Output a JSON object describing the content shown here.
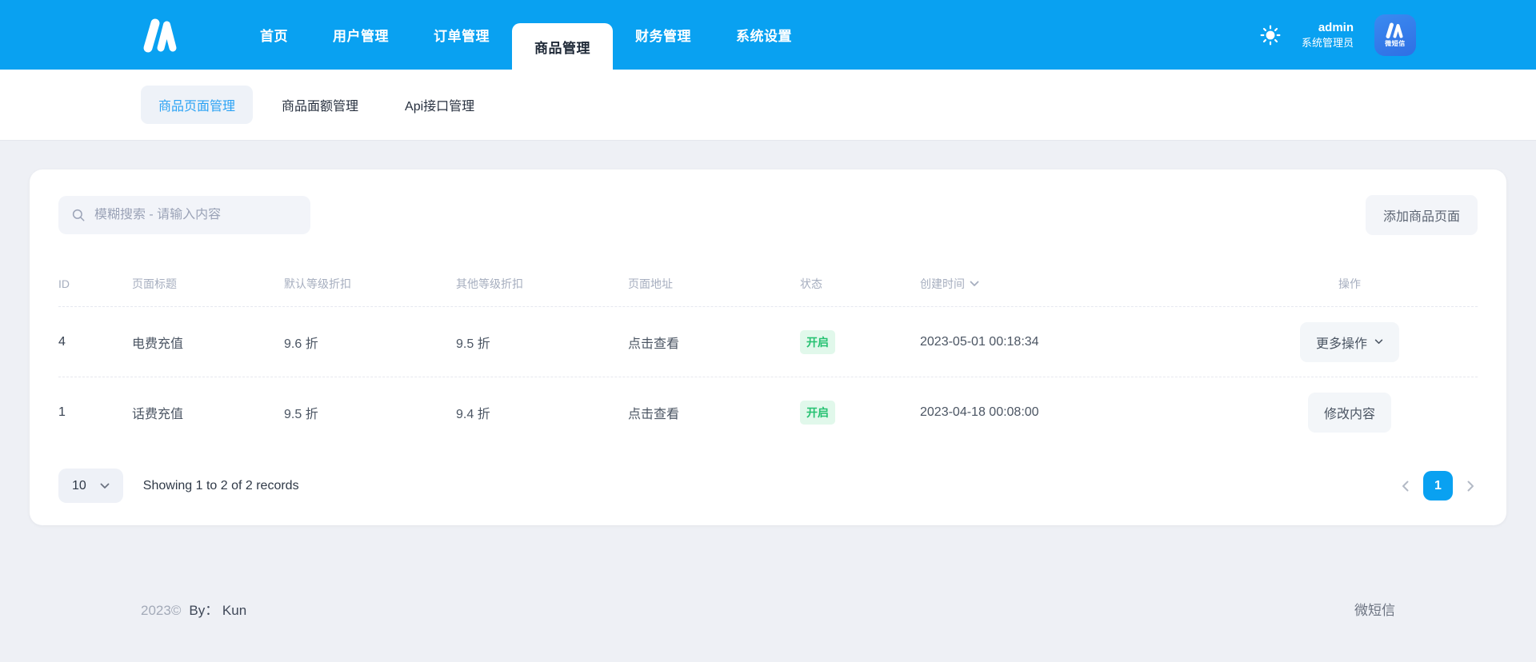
{
  "theme": {
    "header_bg": "#09a1f1",
    "accent": "#09a1f1",
    "status_green": "#25c171",
    "status_green_bg": "#e1f8eb"
  },
  "header": {
    "nav": [
      {
        "label": "首页",
        "active": false
      },
      {
        "label": "用户管理",
        "active": false
      },
      {
        "label": "订单管理",
        "active": false
      },
      {
        "label": "商品管理",
        "active": true
      },
      {
        "label": "财务管理",
        "active": false
      },
      {
        "label": "系统设置",
        "active": false
      }
    ],
    "user": {
      "name": "admin",
      "role": "系统管理员"
    },
    "avatar_brand": "微短信"
  },
  "subnav": {
    "tabs": [
      {
        "label": "商品页面管理",
        "active": true
      },
      {
        "label": "商品面额管理",
        "active": false
      },
      {
        "label": "Api接口管理",
        "active": false
      }
    ]
  },
  "toolbar": {
    "search_placeholder": "模糊搜索 - 请输入内容",
    "add_button": "添加商品页面"
  },
  "table": {
    "columns": {
      "id": "ID",
      "title": "页面标题",
      "default_discount": "默认等级折扣",
      "other_discount": "其他等级折扣",
      "page_link": "页面地址",
      "status": "状态",
      "created_at": "创建时间",
      "action": "操作"
    },
    "rows": [
      {
        "id": "4",
        "title": "电费充值",
        "default_discount": "9.6 折",
        "other_discount": "9.5 折",
        "page_link": "点击查看",
        "status": "开启",
        "created_at": "2023-05-01 00:18:34",
        "action": "更多操作"
      },
      {
        "id": "1",
        "title": "话费充值",
        "default_discount": "9.5 折",
        "other_discount": "9.4 折",
        "page_link": "点击查看",
        "status": "开启",
        "created_at": "2023-04-18 00:08:00",
        "action": "修改内容"
      }
    ]
  },
  "pagination": {
    "page_size": "10",
    "summary": "Showing 1 to 2 of 2 records",
    "current_page": "1"
  },
  "footer": {
    "year": "2023©",
    "by": "By： Kun",
    "right": "微短信"
  }
}
